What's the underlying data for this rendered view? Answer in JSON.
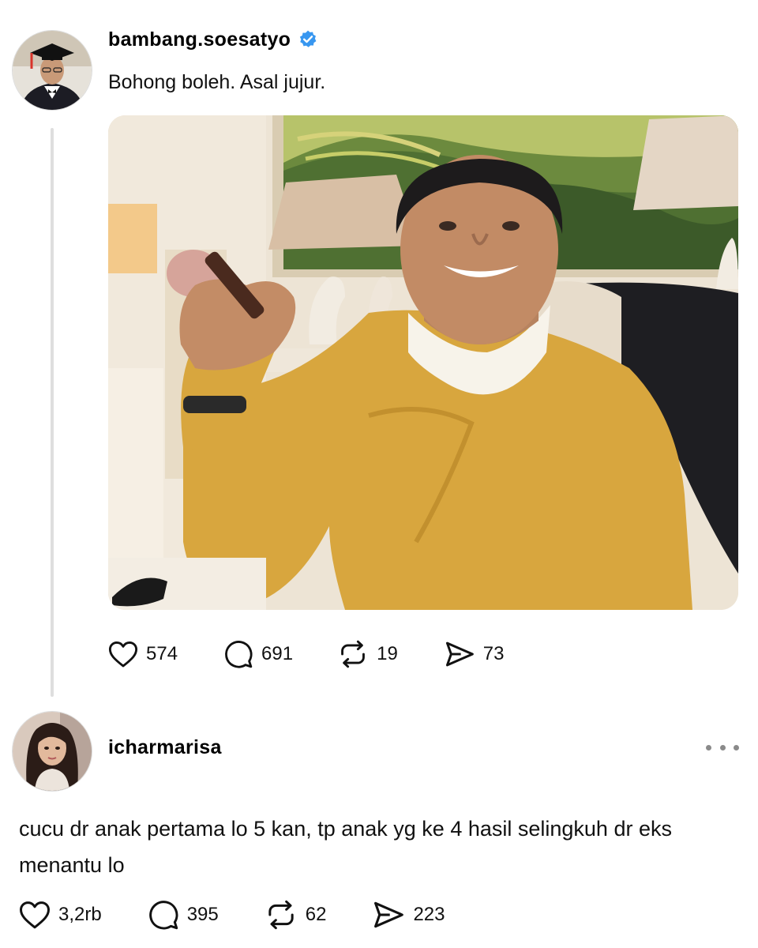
{
  "post": {
    "username": "bambang.soesatyo",
    "text": "Bohong boleh. Asal jujur.",
    "actions": {
      "likes": "574",
      "comments": "691",
      "reposts": "19",
      "shares": "73"
    }
  },
  "reply": {
    "username": "icharmarisa",
    "text": "cucu dr anak pertama lo 5 kan, tp anak yg ke 4 hasil selingkuh dr eks menantu lo",
    "actions": {
      "likes": "3,2rb",
      "comments": "395",
      "reposts": "62",
      "shares": "223"
    }
  },
  "colors": {
    "verified": "#3897f0",
    "text": "#111111",
    "icon": "#111111",
    "thread_line": "#dedede",
    "sweater": "#d8a63e"
  },
  "icons": [
    "verified-badge-icon",
    "heart-icon",
    "comment-icon",
    "repost-icon",
    "share-icon",
    "more-icon"
  ]
}
